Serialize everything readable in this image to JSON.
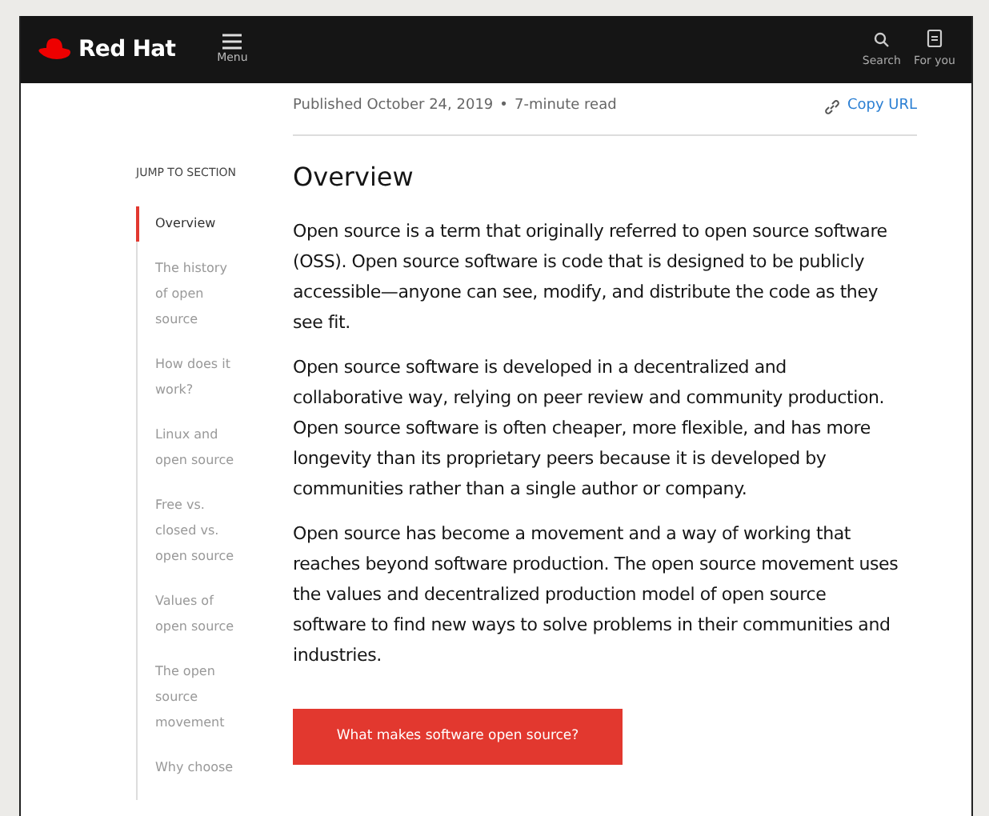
{
  "header": {
    "logo_text": "Red Hat",
    "menu_label": "Menu",
    "actions": [
      {
        "kind": "search",
        "label": "Search"
      },
      {
        "kind": "foryou",
        "label": "For you"
      }
    ]
  },
  "meta": {
    "published": "Published October 24, 2019",
    "separator": "•",
    "read_time": "7-minute read",
    "copy_link": "Copy URL"
  },
  "jump": {
    "title": "JUMP TO SECTION",
    "items": [
      {
        "label": "Overview",
        "selected": true
      },
      {
        "label": "The history of open source",
        "selected": false
      },
      {
        "label": "How does it work?",
        "selected": false
      },
      {
        "label": "Linux and open source",
        "selected": false
      },
      {
        "label": "Free vs. closed vs. open source",
        "selected": false
      },
      {
        "label": "Values of open source",
        "selected": false
      },
      {
        "label": "The open source movement",
        "selected": false
      },
      {
        "label": "Why choose",
        "selected": false
      }
    ]
  },
  "article": {
    "heading": "Overview",
    "paragraphs": [
      "Open source is a term that originally referred to open source software (OSS). Open source software is code that is designed to be publicly accessible—anyone can see, modify, and distribute the code as they see fit.",
      "Open source software is developed in a decentralized and collaborative way, relying on peer review and community production. Open source software is often cheaper, more flexible, and has more longevity than its proprietary peers because it is developed by communities rather than a single author or company.",
      "Open source has become a movement and a way of working that reaches beyond software production. The open source movement uses the values and decentralized production model of open source software to find new ways to solve problems in their communities and industries."
    ],
    "button": "What makes software open source?"
  }
}
